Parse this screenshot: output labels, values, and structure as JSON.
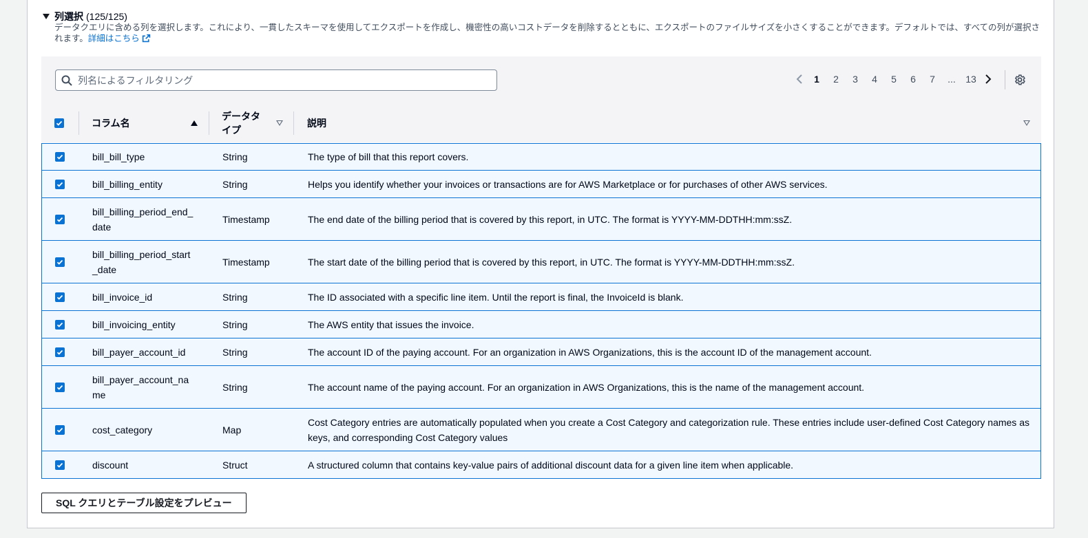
{
  "section": {
    "title": "列選択",
    "count": "(125/125)",
    "description": "データクエリに含める列を選択します。これにより、一貫したスキーマを使用してエクスポートを作成し、機密性の高いコストデータを削除するとともに、エクスポートのファイルサイズを小さくすることができます。デフォルトでは、すべての列が選択されます。",
    "link_label": "詳細はこちら"
  },
  "search": {
    "placeholder": "列名によるフィルタリング",
    "value": ""
  },
  "pagination": {
    "pages": [
      "1",
      "2",
      "3",
      "4",
      "5",
      "6",
      "7",
      "...",
      "13"
    ],
    "current": "1"
  },
  "table": {
    "headers": {
      "name": "コラム名",
      "type": "データタイプ",
      "description": "説明"
    },
    "rows": [
      {
        "name": "bill_bill_type",
        "type": "String",
        "description": "The type of bill that this report covers.",
        "checked": true
      },
      {
        "name": "bill_billing_entity",
        "type": "String",
        "description": "Helps you identify whether your invoices or transactions are for AWS Marketplace or for purchases of other AWS services.",
        "checked": true
      },
      {
        "name": "bill_billing_period_end_date",
        "type": "Timestamp",
        "description": "The end date of the billing period that is covered by this report, in UTC. The format is YYYY-MM-DDTHH:mm:ssZ.",
        "checked": true
      },
      {
        "name": "bill_billing_period_start_date",
        "type": "Timestamp",
        "description": "The start date of the billing period that is covered by this report, in UTC. The format is YYYY-MM-DDTHH:mm:ssZ.",
        "checked": true
      },
      {
        "name": "bill_invoice_id",
        "type": "String",
        "description": "The ID associated with a specific line item. Until the report is final, the InvoiceId is blank.",
        "checked": true
      },
      {
        "name": "bill_invoicing_entity",
        "type": "String",
        "description": "The AWS entity that issues the invoice.",
        "checked": true
      },
      {
        "name": "bill_payer_account_id",
        "type": "String",
        "description": "The account ID of the paying account. For an organization in AWS Organizations, this is the account ID of the management account.",
        "checked": true
      },
      {
        "name": "bill_payer_account_name",
        "type": "String",
        "description": "The account name of the paying account. For an organization in AWS Organizations, this is the name of the management account.",
        "checked": true
      },
      {
        "name": "cost_category",
        "type": "Map",
        "description": "Cost Category entries are automatically populated when you create a Cost Category and categorization rule. These entries include user-defined Cost Category names as keys, and corresponding Cost Category values",
        "checked": true
      },
      {
        "name": "discount",
        "type": "Struct",
        "description": "A structured column that contains key-value pairs of additional discount data for a given line item when applicable.",
        "checked": true
      }
    ]
  },
  "preview_button": "SQL クエリとテーブル設定をプレビュー",
  "colors": {
    "accent": "#0972d3",
    "selected_row_bg": "#f1f8ff",
    "header_bg": "#f4f4f6"
  },
  "icons": {
    "search": "search-icon",
    "external": "external-link-icon",
    "settings": "gear-icon",
    "prev": "chevron-left-icon",
    "next": "chevron-right-icon"
  }
}
